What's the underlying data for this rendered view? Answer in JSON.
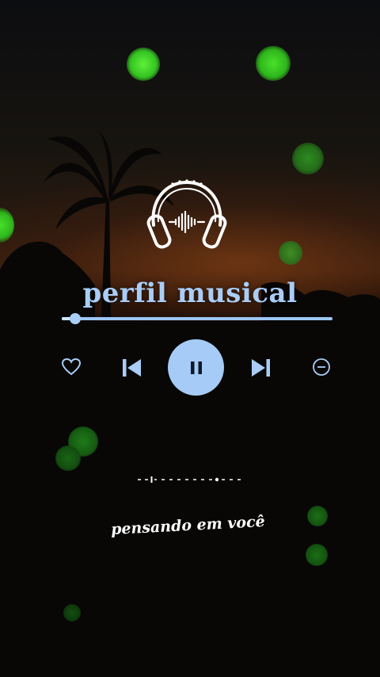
{
  "player": {
    "title": "perfil musical",
    "progress": 0.05,
    "caption": "pensando em você"
  },
  "controls": {
    "like_icon": "heart-icon",
    "previous_icon": "skip-previous-icon",
    "play_pause_icon": "pause-icon",
    "next_icon": "skip-next-icon",
    "remove_icon": "minus-circle-icon"
  },
  "colors": {
    "accent": "#a9cdf6",
    "bokeh": "#3fd32a",
    "sky_glow": "#8a3a12"
  }
}
